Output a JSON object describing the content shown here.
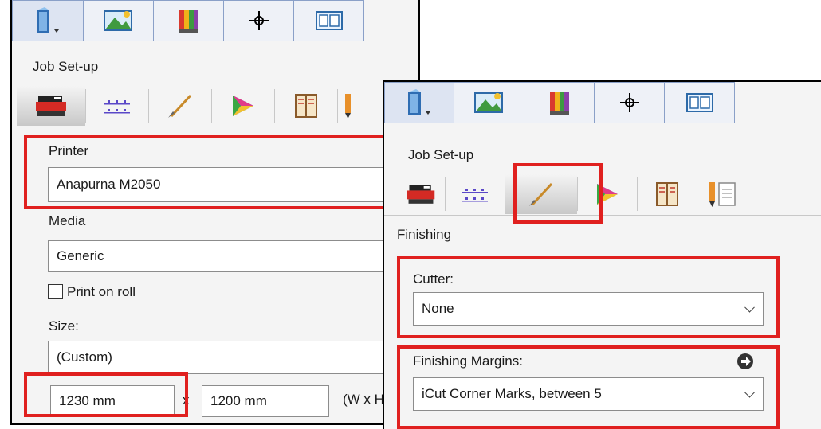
{
  "back_panel": {
    "job_setup_label": "Job Set-up",
    "printer": {
      "label": "Printer",
      "value": "Anapurna M2050"
    },
    "media": {
      "label": "Media",
      "value": "Generic"
    },
    "print_on_roll": {
      "label": "Print on roll",
      "checked": false
    },
    "size": {
      "label": "Size:",
      "value": "(Custom)"
    },
    "width": "1230 mm",
    "separator": "x",
    "height": "1200 mm",
    "dimension_hint": "(W x H"
  },
  "front_panel": {
    "job_setup_label": "Job Set-up",
    "section_title": "Finishing",
    "cutter": {
      "label": "Cutter:",
      "value": "None"
    },
    "finishing_margins": {
      "label": "Finishing Margins:",
      "value": "iCut Corner Marks, between 5"
    }
  },
  "top_tabs": [
    "job-icon",
    "image-icon",
    "color-swatch-icon",
    "crosshair-icon",
    "layout-icon"
  ],
  "sub_tabs": [
    "printer-icon",
    "grid-marks-icon",
    "knife-icon",
    "color-gamut-icon",
    "book-icon",
    "pencil-icon",
    "document-icon"
  ],
  "colors": {
    "highlight": "#e0201f",
    "tab_border": "#8aa0c8",
    "panel_bg": "#f4f4f4"
  }
}
